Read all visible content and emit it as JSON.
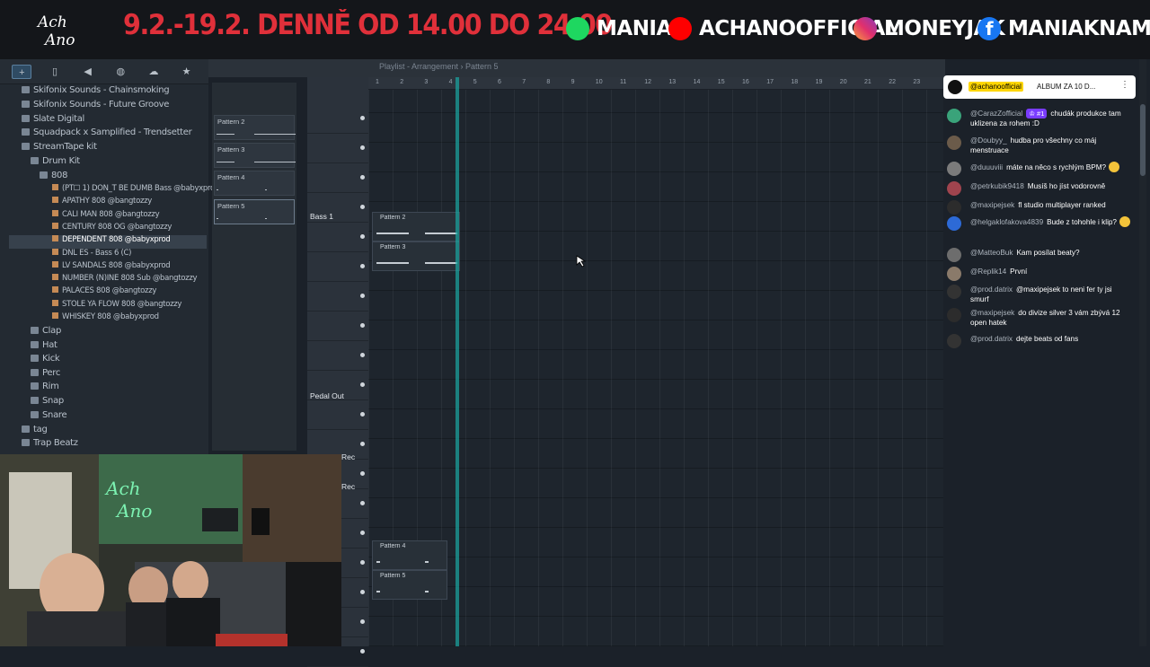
{
  "banner": {
    "logo_text": "Ach Ano",
    "dates": "9.2.-19.2. DENNĚ OD 14.00 DO 24.00",
    "spotify": "MANIAK",
    "youtube": "ACHANOOFFICIAL",
    "instagram": "MONEYJAK",
    "facebook": "MANIAKNAME",
    "colors": {
      "dates": "#e0303a",
      "spotify": "#1ed760",
      "youtube": "#ff0000",
      "facebook": "#1877f2"
    }
  },
  "browser": {
    "toolbar_icons": [
      "plus-icon",
      "file-icon",
      "speaker-icon",
      "globe-icon",
      "cloud-icon",
      "star-icon"
    ],
    "items": [
      {
        "label": "Skifonix Sounds - Chainsmoking"
      },
      {
        "label": "Skifonix Sounds - Future Groove"
      },
      {
        "label": "Slate Digital"
      },
      {
        "label": "Squadpack x Samplified - Trendsetter"
      },
      {
        "label": "StreamTape kit"
      },
      {
        "label": "Drum Kit"
      },
      {
        "label": "808"
      },
      {
        "label": "(PT☐ 1) DON_T BE DUMB Bass @babyxprod"
      },
      {
        "label": "APATHY 808 @bangtozzy"
      },
      {
        "label": "CALI MAN 808 @bangtozzy"
      },
      {
        "label": "CENTURY 808 OG @bangtozzy"
      },
      {
        "label": "DEPENDENT 808 @babyxprod"
      },
      {
        "label": "DNL ES - Bass 6 (C)"
      },
      {
        "label": "LV SANDALS 808 @babyxprod"
      },
      {
        "label": "NUMBER (N)INE 808 Sub @bangtozzy"
      },
      {
        "label": "PALACES 808 @bangtozzy"
      },
      {
        "label": "STOLE YA FLOW 808 @bangtozzy"
      },
      {
        "label": "WHISKEY 808 @babyxprod"
      },
      {
        "label": "Clap"
      },
      {
        "label": "Hat"
      },
      {
        "label": "Kick"
      },
      {
        "label": "Perc"
      },
      {
        "label": "Rim"
      },
      {
        "label": "Snap"
      },
      {
        "label": "Snare"
      },
      {
        "label": "tag"
      },
      {
        "label": "Trap Beatz"
      }
    ]
  },
  "daw": {
    "title": "Playlist - Arrangement › Pattern 5",
    "patterns": [
      "Pattern 2",
      "Pattern 3",
      "Pattern 4",
      "Pattern 5"
    ],
    "tracks": [
      "Bass 1",
      "Pedal Out",
      "Rec",
      "Rec"
    ],
    "ruler": [
      "1",
      "2",
      "3",
      "4",
      "5",
      "6",
      "7",
      "8",
      "9",
      "10",
      "11",
      "12",
      "13",
      "14",
      "15",
      "16",
      "17",
      "18",
      "19",
      "20",
      "21",
      "22",
      "23"
    ],
    "clips": [
      "Pattern 2",
      "Pattern 3",
      "Pattern 4",
      "Pattern 5"
    ]
  },
  "chat": {
    "pinned": {
      "user": "@achanoofficial",
      "message": "ALBUM ZA 10 D..."
    },
    "messages": [
      {
        "user": "@CarazZofficial",
        "badge": "♔ #1",
        "text": "chudák produkce tam uklizena za rohem :D"
      },
      {
        "user": "@Doubyy_",
        "text": "hudba pro všechny co máj menstruace"
      },
      {
        "user": "@duuuviii",
        "text": "máte na něco s rychlým BPM?"
      },
      {
        "user": "@petrkubik9418",
        "text": "Musíš ho jíst vodorovně"
      },
      {
        "user": "@maxipejsek",
        "text": "fl studio multiplayer ranked"
      },
      {
        "user": "@helgaklofakova4839",
        "text": "Bude z tohohle i klip?"
      },
      {
        "user": "@MatteoBuk",
        "text": "Kam posílat beaty?"
      },
      {
        "user": "@Replik14",
        "text": "První"
      },
      {
        "user": "@prod.datrix",
        "text": "@maxipejsek to neni fer ty jsi smurf"
      },
      {
        "user": "@maxipejsek",
        "text": "do divize silver 3 vám zbývá 12 open hatek"
      },
      {
        "user": "@prod.datrix",
        "text": "dejte beats od fans"
      }
    ]
  }
}
